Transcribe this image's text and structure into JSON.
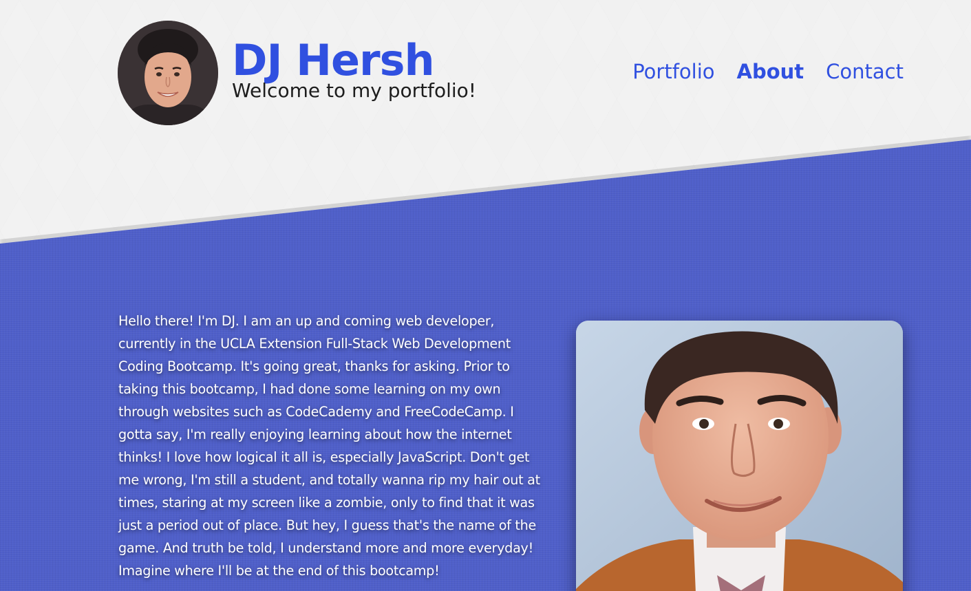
{
  "header": {
    "avatar_alt": "DJ Hersh headshot",
    "name": "DJ Hersh",
    "tagline": "Welcome to my portfolio!"
  },
  "nav": {
    "items": [
      {
        "label": "Portfolio",
        "active": false
      },
      {
        "label": "About",
        "active": true
      },
      {
        "label": "Contact",
        "active": false
      }
    ]
  },
  "about": {
    "paragraph": "Hello there! I'm DJ. I am an up and coming web developer, currently in the UCLA Extension Full-Stack Web Development Coding Bootcamp. It's going great, thanks for asking. Prior to taking this bootcamp, I had done some learning on my own through websites such as CodeCademy and FreeCodeCamp. I gotta say, I'm really enjoying learning about how the internet thinks! I love how logical it all is, especially JavaScript. Don't get me wrong, I'm still a student, and totally wanna rip my hair out at times, staring at my screen like a zombie, only to find that it was just a period out of place. But hey, I guess that's the name of the game. And truth be told, I understand more and more everyday! Imagine where I'll be at the end of this bootcamp!",
    "photo_alt": "Portrait of DJ Hersh"
  },
  "colors": {
    "accent": "#3050e0",
    "band": "#4f5fc9",
    "tagline": "#1d1d1d",
    "body_text": "#ffffff"
  }
}
